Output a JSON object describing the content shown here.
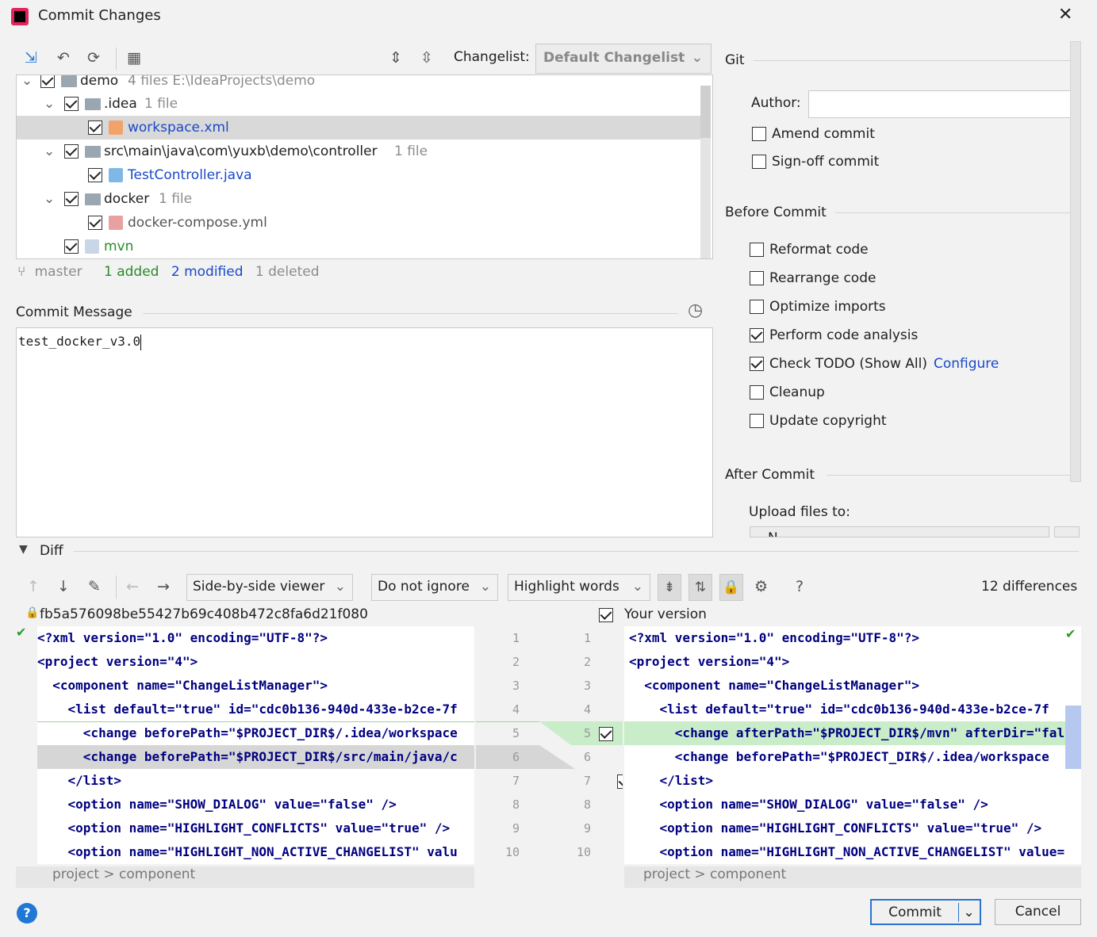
{
  "window": {
    "title": "Commit Changes"
  },
  "changes_toolbar": {
    "changelist_label": "Changelist:",
    "changelist_value": "Default Changelist"
  },
  "tree": {
    "root": {
      "name": "demo",
      "meta": "4 files  E:\\IdeaProjects\\demo"
    },
    "idea": {
      "name": ".idea",
      "meta": "1 file"
    },
    "workspace": {
      "name": "workspace.xml",
      "icon": "xml-file-icon"
    },
    "controller": {
      "name": "src\\main\\java\\com\\yuxb\\demo\\controller",
      "meta": "1 file"
    },
    "testcontroller": {
      "name": "TestController.java",
      "icon": "java-file-icon"
    },
    "docker": {
      "name": "docker",
      "meta": "1 file"
    },
    "compose": {
      "name": "docker-compose.yml",
      "icon": "yml-file-icon"
    },
    "mvn": {
      "name": "mvn",
      "icon": "unknown-file-icon"
    }
  },
  "status": {
    "branch": "master",
    "added": "1 added",
    "modified": "2 modified",
    "deleted": "1 deleted"
  },
  "commit_message": {
    "label": "Commit Message",
    "value": "test_docker_v3.0"
  },
  "git": {
    "section": "Git",
    "author_label": "Author:",
    "author_value": "",
    "amend": "Amend commit",
    "signoff": "Sign-off commit"
  },
  "before_commit": {
    "section": "Before Commit",
    "options": [
      {
        "label": "Reformat code",
        "checked": false
      },
      {
        "label": "Rearrange code",
        "checked": false
      },
      {
        "label": "Optimize imports",
        "checked": false
      },
      {
        "label": "Perform code analysis",
        "checked": true
      },
      {
        "label": "Check TODO (Show All)",
        "checked": true,
        "link": "Configure"
      },
      {
        "label": "Cleanup",
        "checked": false
      },
      {
        "label": "Update copyright",
        "checked": false
      }
    ]
  },
  "after_commit": {
    "section": "After Commit",
    "upload_label": "Upload files to:",
    "upload_value": "N"
  },
  "diff": {
    "section": "Diff",
    "viewer": "Side-by-side viewer",
    "ignore": "Do not ignore",
    "highlight": "Highlight words",
    "differences": "12 differences",
    "left_title": "fb5a576098be55427b69c408b472c8fa6d21f080",
    "right_title": "Your version",
    "left_lines": [
      "<?xml version=\"1.0\" encoding=\"UTF-8\"?>",
      "<project version=\"4\">",
      "  <component name=\"ChangeListManager\">",
      "    <list default=\"true\" id=\"cdc0b136-940d-433e-b2ce-7f",
      "      <change beforePath=\"$PROJECT_DIR$/.idea/workspace",
      "      <change beforePath=\"$PROJECT_DIR$/src/main/java/c",
      "    </list>",
      "    <option name=\"SHOW_DIALOG\" value=\"false\" />",
      "    <option name=\"HIGHLIGHT_CONFLICTS\" value=\"true\" />",
      "    <option name=\"HIGHLIGHT_NON_ACTIVE_CHANGELIST\" valu"
    ],
    "right_lines": [
      "<?xml version=\"1.0\" encoding=\"UTF-8\"?>",
      "<project version=\"4\">",
      "  <component name=\"ChangeListManager\">",
      "    <list default=\"true\" id=\"cdc0b136-940d-433e-b2ce-7f",
      "      <change afterPath=\"$PROJECT_DIR$/mvn\" afterDir=\"fal",
      "      <change beforePath=\"$PROJECT_DIR$/.idea/workspace",
      "    </list>",
      "    <option name=\"SHOW_DIALOG\" value=\"false\" />",
      "    <option name=\"HIGHLIGHT_CONFLICTS\" value=\"true\" />",
      "    <option name=\"HIGHLIGHT_NON_ACTIVE_CHANGELIST\" value="
    ],
    "line_numbers": [
      "1",
      "2",
      "3",
      "4",
      "5",
      "6",
      "7",
      "8",
      "9",
      "10"
    ],
    "left_breadcrumb": "project > component",
    "right_breadcrumb": "project > component"
  },
  "footer": {
    "commit": "Commit",
    "cancel": "Cancel",
    "help": "?"
  }
}
